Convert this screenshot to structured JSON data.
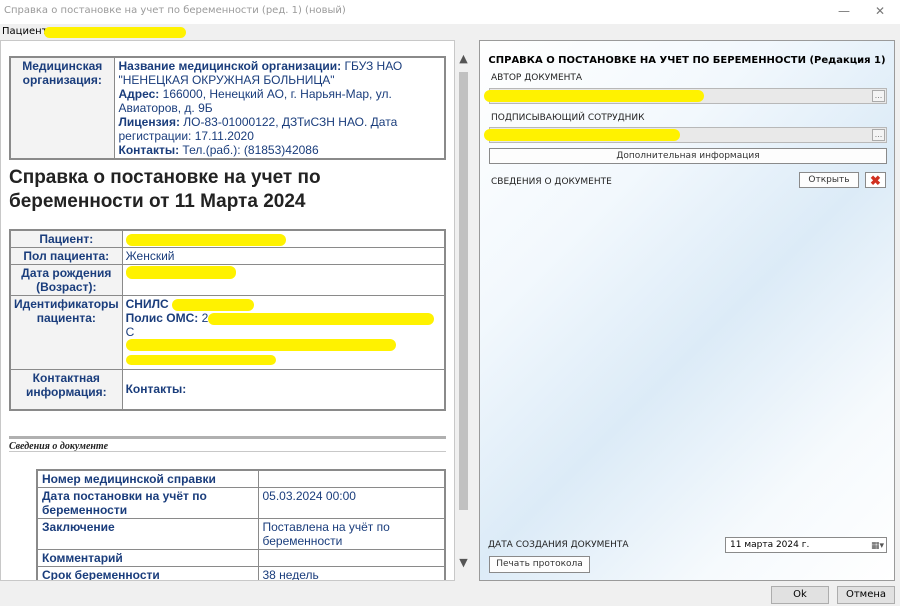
{
  "window": {
    "title": "Справка о постановке на учет по беременности (ред. 1) (новый)",
    "minimize": "—",
    "maximize": "☐",
    "close": "✕"
  },
  "patient_bar": {
    "label": "Пациент"
  },
  "org": {
    "header": "Медицинская организация:",
    "name_label": "Название медицинской организации:",
    "name_value1": " ГБУЗ НАО",
    "name_value2": "\"НЕНЕЦКАЯ ОКРУЖНАЯ БОЛЬНИЦА\"",
    "address_label": "Адрес:",
    "address_value1": " 166000, Ненецкий АО, г. Нарьян-Мар, ул.",
    "address_value2": "Авиаторов, д. 9Б",
    "license_label": "Лицензия:",
    "license_value1": " ЛО-83-01000122, ДЗТиСЗН НАО. Дата",
    "license_value2": "регистрации: 17.11.2020",
    "contacts_label": "Контакты:",
    "contacts_value": " Тел.(раб.): (81853)42086"
  },
  "doc_title": "Справка о постановке на учет по беременности от 11 Марта 2024",
  "patient": {
    "patient_label": "Пациент:",
    "sex_label": "Пол пациента:",
    "sex_value": "Женский",
    "birth_label": "Дата рождения (Возраст):",
    "ids_label": "Идентификаторы пациента:",
    "snils_label": "СНИЛС",
    "oms_label": "Полис ОМС:",
    "oms_value": " 2",
    "oms_tail": "С",
    "contact_label": "Контактная информация:",
    "contacts_value": "Контакты:"
  },
  "doc_section": {
    "title": "Сведения о документе"
  },
  "details": [
    {
      "label": "Номер медицинской справки",
      "value": ""
    },
    {
      "label": "Дата постановки на учёт по беременности",
      "value": "05.03.2024 00:00"
    },
    {
      "label": "Заключение",
      "value": "Поставлена на учёт по беременности"
    },
    {
      "label": "Комментарий",
      "value": ""
    },
    {
      "label": "Срок беременности",
      "value": "38 недель"
    }
  ],
  "right_panel": {
    "title": "СПРАВКА О ПОСТАНОВКЕ НА УЧЕТ ПО БЕРЕМЕННОСТИ (Редакция 1)",
    "author_label": "АВТОР ДОКУМЕНТА",
    "signer_label": "ПОДПИСЫВАЮЩИЙ СОТРУДНИК",
    "field_button": "…",
    "additional_info_button": "Дополнительная информация",
    "doc_info_label": "СВЕДЕНИЯ О ДОКУМЕНТЕ",
    "open_button": "Открыть",
    "delete_icon": "✖",
    "creation_date_label": "ДАТА СОЗДАНИЯ ДОКУМЕНТА",
    "creation_date_value": "11  марта  2024 г.",
    "calendar_icon": "▦▾",
    "print_button": "Печать протокола"
  },
  "buttons": {
    "ok": "Ok",
    "cancel": "Отмена"
  },
  "scroll": {
    "up": "▲",
    "down": "▼"
  },
  "colors": {
    "highlight": "#fff200",
    "label_blue": "#1a3d7c"
  }
}
